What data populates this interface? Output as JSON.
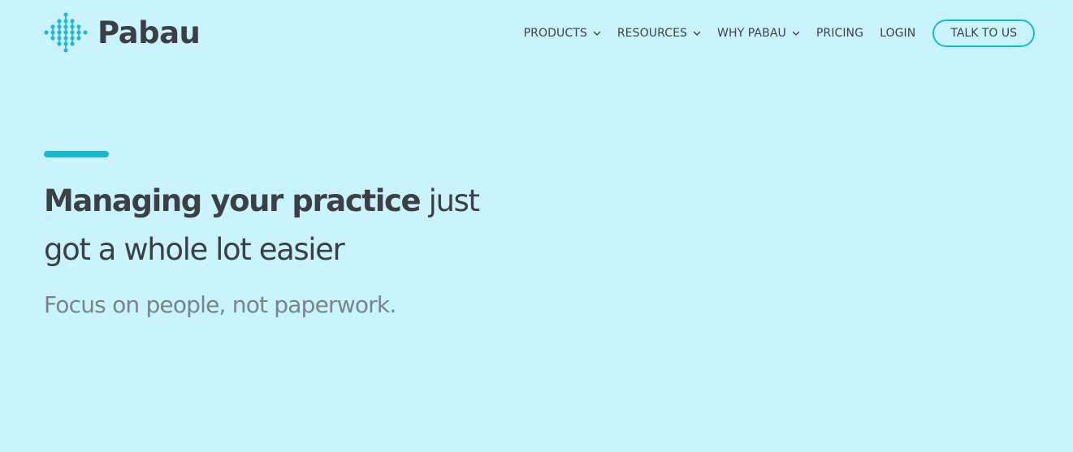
{
  "brand": {
    "name": "Pabau",
    "accent_color": "#18b7d9",
    "background_color": "#caf4fd",
    "text_color": "#3c3f44"
  },
  "nav": {
    "items": [
      {
        "label": "PRODUCTS",
        "has_dropdown": true
      },
      {
        "label": "RESOURCES",
        "has_dropdown": true
      },
      {
        "label": "WHY PABAU",
        "has_dropdown": true
      },
      {
        "label": "PRICING",
        "has_dropdown": false
      },
      {
        "label": "LOGIN",
        "has_dropdown": false
      }
    ],
    "cta_label": "TALK TO US"
  },
  "hero": {
    "title_bold": "Managing your practice",
    "title_rest": " just got a whole lot easier",
    "subtitle": "Focus on people, not paperwork."
  }
}
